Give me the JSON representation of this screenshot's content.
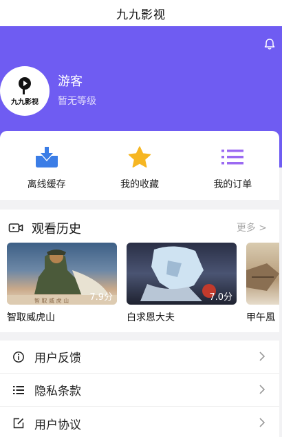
{
  "app": {
    "title": "九九影视"
  },
  "user": {
    "name": "游客",
    "level": "暂无等级",
    "avatar_text": "九九影视"
  },
  "colors": {
    "accent": "#6f5cf2",
    "download": "#3b7de6",
    "star": "#f6b622",
    "orders": "#9b6af2"
  },
  "quick_actions": [
    {
      "label": "离线缓存",
      "icon": "download-tray-icon"
    },
    {
      "label": "我的收藏",
      "icon": "star-icon"
    },
    {
      "label": "我的订单",
      "icon": "list-icon"
    }
  ],
  "history": {
    "title": "观看历史",
    "more": "更多 >",
    "items": [
      {
        "name": "智取威虎山",
        "score": "7.9分"
      },
      {
        "name": "白求恩大夫",
        "score": "7.0分"
      },
      {
        "name": "甲午風",
        "score": ""
      }
    ]
  },
  "menu": [
    {
      "label": "用户反馈",
      "icon": "info-circle-icon"
    },
    {
      "label": "隐私条款",
      "icon": "list-icon"
    },
    {
      "label": "用户协议",
      "icon": "edit-square-icon"
    }
  ]
}
